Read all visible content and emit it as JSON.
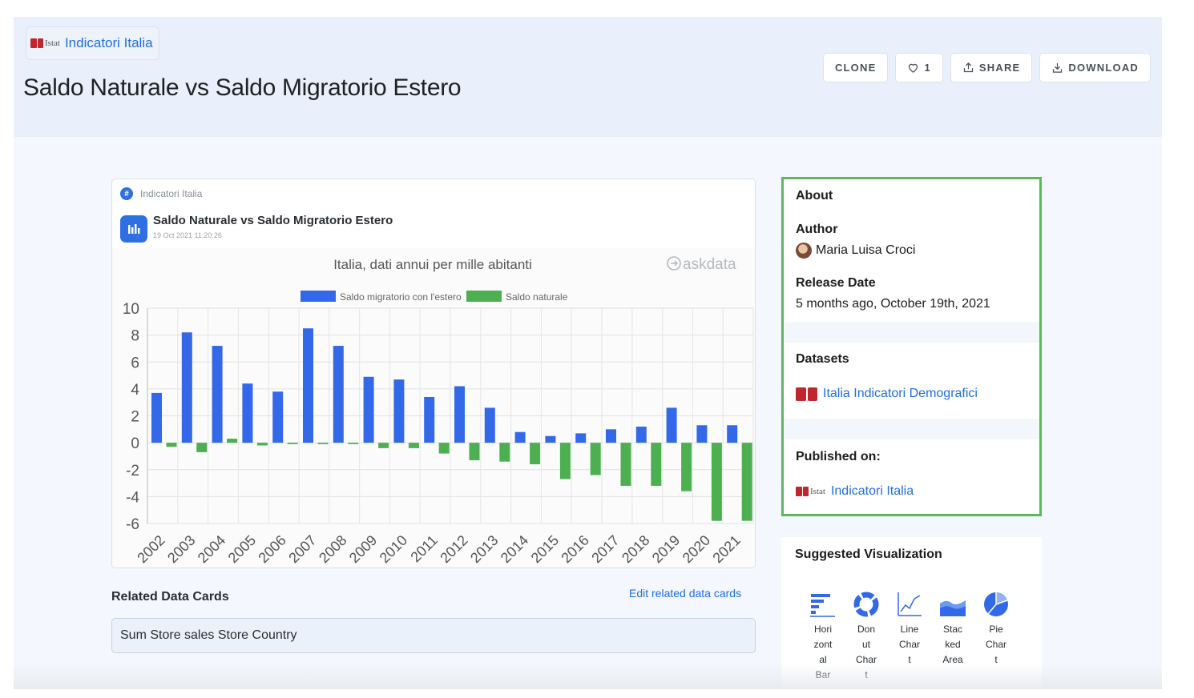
{
  "header": {
    "org_logo_text": "Istat",
    "org_name": "Indicatori Italia",
    "title": "Saldo Naturale vs Saldo Migratorio Estero",
    "actions": {
      "clone": "CLONE",
      "like_count": "1",
      "share": "SHARE",
      "download": "DOWNLOAD"
    }
  },
  "card": {
    "org_name": "Indicatori Italia",
    "title": "Saldo Naturale vs Saldo Migratorio Estero",
    "date": "19 Oct 2021 11:20:26",
    "watermark": "askdata"
  },
  "chart_data": {
    "type": "bar",
    "title": "Italia, dati annui per mille abitanti",
    "legend_position": "top",
    "categories": [
      "2002",
      "2003",
      "2004",
      "2005",
      "2006",
      "2007",
      "2008",
      "2009",
      "2010",
      "2011",
      "2012",
      "2013",
      "2014",
      "2015",
      "2016",
      "2017",
      "2018",
      "2019",
      "2020",
      "2021"
    ],
    "series": [
      {
        "name": "Saldo migratorio con l'estero",
        "color": "#3369e8",
        "values": [
          3.7,
          8.2,
          7.2,
          4.4,
          3.8,
          8.5,
          7.2,
          4.9,
          4.7,
          3.4,
          4.2,
          2.6,
          0.8,
          0.5,
          0.7,
          1.0,
          1.2,
          2.6,
          1.3,
          1.3
        ]
      },
      {
        "name": "Saldo naturale",
        "color": "#4caf50",
        "values": [
          -0.3,
          -0.7,
          0.3,
          -0.2,
          -0.1,
          -0.1,
          -0.1,
          -0.4,
          -0.4,
          -0.8,
          -1.3,
          -1.4,
          -1.6,
          -2.7,
          -2.4,
          -3.2,
          -3.2,
          -3.6,
          -5.8,
          -5.8
        ]
      }
    ],
    "ylim": [
      -6,
      10
    ],
    "yticks": [
      10,
      8,
      6,
      4,
      2,
      0,
      -2,
      -4,
      -6
    ],
    "grid": true
  },
  "related": {
    "title": "Related Data Cards",
    "edit_label": "Edit related data cards",
    "items": [
      "Sum Store sales Store Country"
    ]
  },
  "about": {
    "title": "About",
    "author_label": "Author",
    "author_name": "Maria Luisa Croci",
    "release_label": "Release Date",
    "release_value": "5 months ago, October 19th, 2021",
    "datasets_label": "Datasets",
    "dataset_name": "Italia Indicatori Demografici",
    "published_label": "Published on:",
    "published_logo_text": "Istat",
    "published_name": "Indicatori Italia"
  },
  "suggested": {
    "title": "Suggested Visualization",
    "items": [
      {
        "icon": "horizontal-bar-icon",
        "lines": [
          "Hori",
          "zont",
          "al",
          "Bar"
        ]
      },
      {
        "icon": "donut-chart-icon",
        "lines": [
          "Don",
          "ut",
          "Char",
          "t"
        ]
      },
      {
        "icon": "line-chart-icon",
        "lines": [
          "Line",
          "Char",
          "t"
        ]
      },
      {
        "icon": "stacked-area-icon",
        "lines": [
          "Stac",
          "ked",
          "Area"
        ]
      },
      {
        "icon": "pie-chart-icon",
        "lines": [
          "Pie",
          "Char",
          "t"
        ]
      }
    ]
  }
}
